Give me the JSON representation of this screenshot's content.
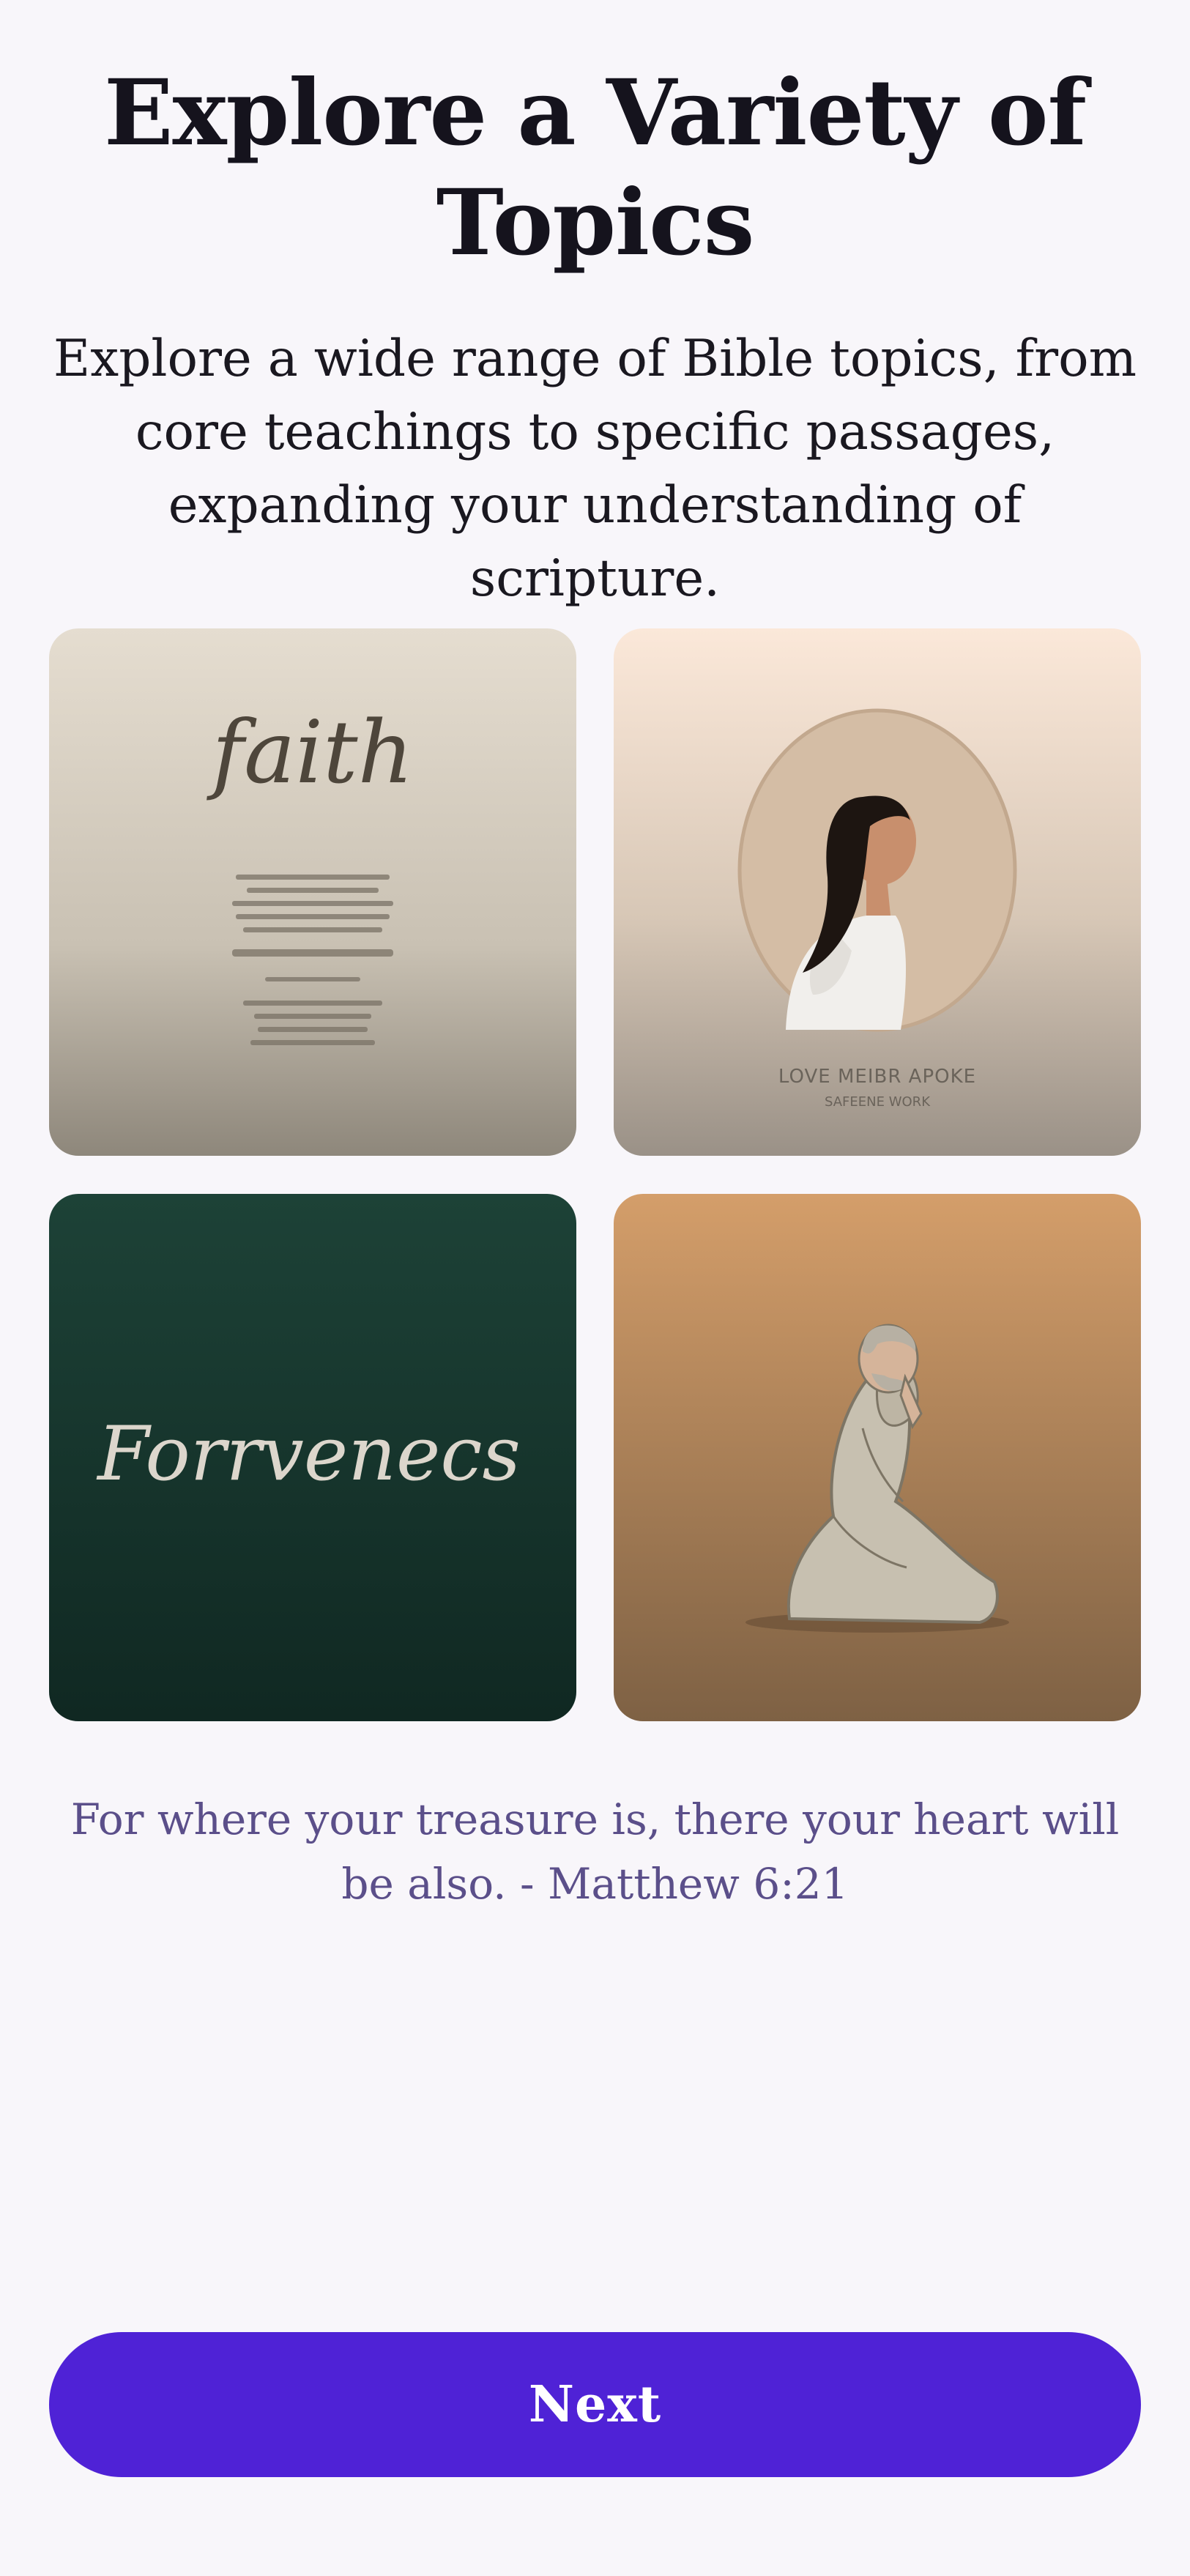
{
  "header": {
    "title": "Explore a Variety of Topics",
    "subtitle": "Explore a wide range of Bible topics, from core teachings to specific passages, expanding your understanding of scripture."
  },
  "topics": [
    {
      "label": "faith",
      "icon": "faith-script-card",
      "accent": "#d8d0c2"
    },
    {
      "label": "LOVE MEIBR APOKE",
      "sublabel": "SAFEENE WORK",
      "icon": "woman-portrait",
      "accent": "#f3e6d9"
    },
    {
      "label": "Forrvenecs",
      "icon": "forgiveness-script-card",
      "accent": "#1a3d33"
    },
    {
      "label": "",
      "icon": "praying-man",
      "accent": "#c8955e"
    }
  ],
  "quote": "For where your treasure is, there your heart will be also. - Matthew 6:21",
  "actions": {
    "next_label": "Next"
  },
  "colors": {
    "background": "#f8f6fa",
    "title": "#15131d",
    "quote": "#5b4f8a",
    "primary_button": "#4f22d6"
  }
}
